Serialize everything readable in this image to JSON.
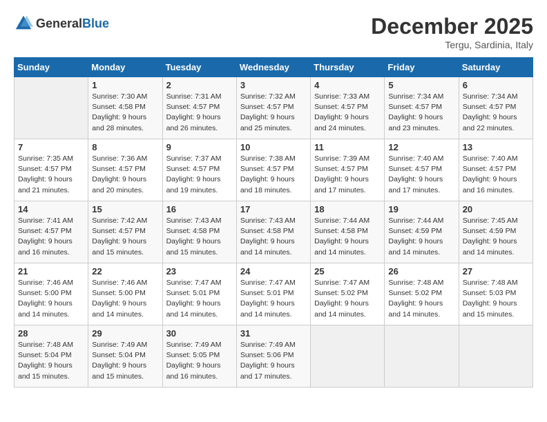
{
  "header": {
    "logo_general": "General",
    "logo_blue": "Blue",
    "month_year": "December 2025",
    "location": "Tergu, Sardinia, Italy"
  },
  "days_of_week": [
    "Sunday",
    "Monday",
    "Tuesday",
    "Wednesday",
    "Thursday",
    "Friday",
    "Saturday"
  ],
  "weeks": [
    [
      {
        "day": "",
        "info": ""
      },
      {
        "day": "1",
        "info": "Sunrise: 7:30 AM\nSunset: 4:58 PM\nDaylight: 9 hours\nand 28 minutes."
      },
      {
        "day": "2",
        "info": "Sunrise: 7:31 AM\nSunset: 4:57 PM\nDaylight: 9 hours\nand 26 minutes."
      },
      {
        "day": "3",
        "info": "Sunrise: 7:32 AM\nSunset: 4:57 PM\nDaylight: 9 hours\nand 25 minutes."
      },
      {
        "day": "4",
        "info": "Sunrise: 7:33 AM\nSunset: 4:57 PM\nDaylight: 9 hours\nand 24 minutes."
      },
      {
        "day": "5",
        "info": "Sunrise: 7:34 AM\nSunset: 4:57 PM\nDaylight: 9 hours\nand 23 minutes."
      },
      {
        "day": "6",
        "info": "Sunrise: 7:34 AM\nSunset: 4:57 PM\nDaylight: 9 hours\nand 22 minutes."
      }
    ],
    [
      {
        "day": "7",
        "info": "Sunrise: 7:35 AM\nSunset: 4:57 PM\nDaylight: 9 hours\nand 21 minutes."
      },
      {
        "day": "8",
        "info": "Sunrise: 7:36 AM\nSunset: 4:57 PM\nDaylight: 9 hours\nand 20 minutes."
      },
      {
        "day": "9",
        "info": "Sunrise: 7:37 AM\nSunset: 4:57 PM\nDaylight: 9 hours\nand 19 minutes."
      },
      {
        "day": "10",
        "info": "Sunrise: 7:38 AM\nSunset: 4:57 PM\nDaylight: 9 hours\nand 18 minutes."
      },
      {
        "day": "11",
        "info": "Sunrise: 7:39 AM\nSunset: 4:57 PM\nDaylight: 9 hours\nand 17 minutes."
      },
      {
        "day": "12",
        "info": "Sunrise: 7:40 AM\nSunset: 4:57 PM\nDaylight: 9 hours\nand 17 minutes."
      },
      {
        "day": "13",
        "info": "Sunrise: 7:40 AM\nSunset: 4:57 PM\nDaylight: 9 hours\nand 16 minutes."
      }
    ],
    [
      {
        "day": "14",
        "info": "Sunrise: 7:41 AM\nSunset: 4:57 PM\nDaylight: 9 hours\nand 16 minutes."
      },
      {
        "day": "15",
        "info": "Sunrise: 7:42 AM\nSunset: 4:57 PM\nDaylight: 9 hours\nand 15 minutes."
      },
      {
        "day": "16",
        "info": "Sunrise: 7:43 AM\nSunset: 4:58 PM\nDaylight: 9 hours\nand 15 minutes."
      },
      {
        "day": "17",
        "info": "Sunrise: 7:43 AM\nSunset: 4:58 PM\nDaylight: 9 hours\nand 14 minutes."
      },
      {
        "day": "18",
        "info": "Sunrise: 7:44 AM\nSunset: 4:58 PM\nDaylight: 9 hours\nand 14 minutes."
      },
      {
        "day": "19",
        "info": "Sunrise: 7:44 AM\nSunset: 4:59 PM\nDaylight: 9 hours\nand 14 minutes."
      },
      {
        "day": "20",
        "info": "Sunrise: 7:45 AM\nSunset: 4:59 PM\nDaylight: 9 hours\nand 14 minutes."
      }
    ],
    [
      {
        "day": "21",
        "info": "Sunrise: 7:46 AM\nSunset: 5:00 PM\nDaylight: 9 hours\nand 14 minutes."
      },
      {
        "day": "22",
        "info": "Sunrise: 7:46 AM\nSunset: 5:00 PM\nDaylight: 9 hours\nand 14 minutes."
      },
      {
        "day": "23",
        "info": "Sunrise: 7:47 AM\nSunset: 5:01 PM\nDaylight: 9 hours\nand 14 minutes."
      },
      {
        "day": "24",
        "info": "Sunrise: 7:47 AM\nSunset: 5:01 PM\nDaylight: 9 hours\nand 14 minutes."
      },
      {
        "day": "25",
        "info": "Sunrise: 7:47 AM\nSunset: 5:02 PM\nDaylight: 9 hours\nand 14 minutes."
      },
      {
        "day": "26",
        "info": "Sunrise: 7:48 AM\nSunset: 5:02 PM\nDaylight: 9 hours\nand 14 minutes."
      },
      {
        "day": "27",
        "info": "Sunrise: 7:48 AM\nSunset: 5:03 PM\nDaylight: 9 hours\nand 15 minutes."
      }
    ],
    [
      {
        "day": "28",
        "info": "Sunrise: 7:48 AM\nSunset: 5:04 PM\nDaylight: 9 hours\nand 15 minutes."
      },
      {
        "day": "29",
        "info": "Sunrise: 7:49 AM\nSunset: 5:04 PM\nDaylight: 9 hours\nand 15 minutes."
      },
      {
        "day": "30",
        "info": "Sunrise: 7:49 AM\nSunset: 5:05 PM\nDaylight: 9 hours\nand 16 minutes."
      },
      {
        "day": "31",
        "info": "Sunrise: 7:49 AM\nSunset: 5:06 PM\nDaylight: 9 hours\nand 17 minutes."
      },
      {
        "day": "",
        "info": ""
      },
      {
        "day": "",
        "info": ""
      },
      {
        "day": "",
        "info": ""
      }
    ]
  ]
}
